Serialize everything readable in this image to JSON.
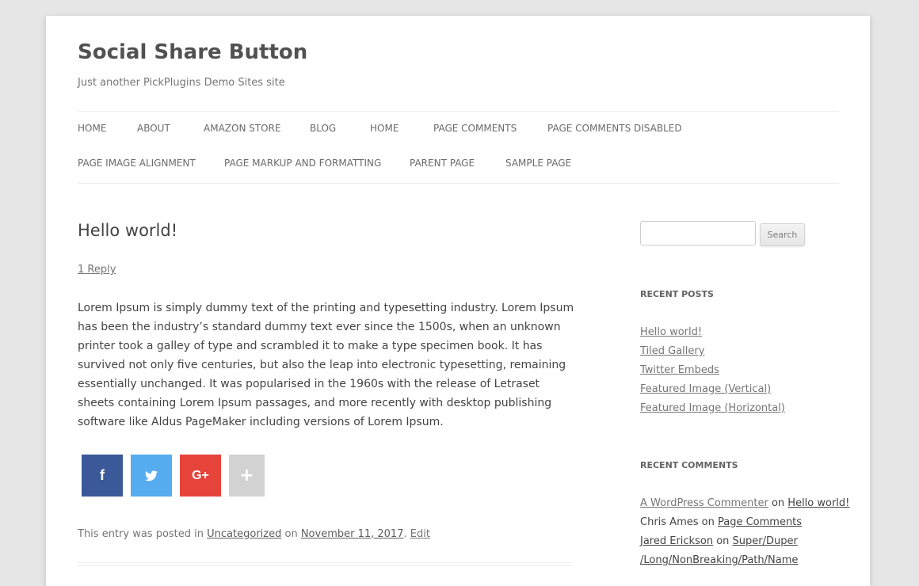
{
  "site": {
    "title": "Social Share Button",
    "description": "Just another PickPlugins Demo Sites site"
  },
  "nav": {
    "row1": [
      "HOME",
      "ABOUT",
      "AMAZON STORE",
      "BLOG",
      "HOME",
      "PAGE COMMENTS",
      "PAGE COMMENTS DISABLED"
    ],
    "row2": [
      "PAGE IMAGE ALIGNMENT",
      "PAGE MARKUP AND FORMATTING",
      "PARENT PAGE",
      "SAMPLE PAGE"
    ]
  },
  "post": {
    "title": "Hello world!",
    "reply_link": "1 Reply",
    "content": "Lorem Ipsum is simply dummy text of the printing and typesetting industry. Lorem Ipsum has been the industry’s standard dummy text ever since the 1500s, when an unknown printer took a galley of type and scrambled it to make a type specimen book. It has survived not only five centuries, but also the leap into electronic typesetting, remaining essentially unchanged. It was popularised in the 1960s with the release of Letraset sheets containing Lorem Ipsum passages, and more recently with desktop publishing software like Aldus PageMaker including versions of Lorem Ipsum.",
    "share": {
      "facebook": "f",
      "twitter_icon": "twitter-icon",
      "googleplus": "G+",
      "more": "+",
      "colors": {
        "facebook": "#3b5998",
        "twitter": "#55acee",
        "googleplus": "#e6443b",
        "more": "#d2d2d2"
      }
    },
    "meta": {
      "prefix": "This entry was posted in ",
      "category": "Uncategorized",
      "on": " on ",
      "date": "November 11, 2017",
      "period": ". ",
      "edit": "Edit"
    }
  },
  "sidebar": {
    "search": {
      "placeholder": "",
      "button": "Search"
    },
    "recent_posts": {
      "title": "RECENT POSTS",
      "items": [
        "Hello world!",
        "Tiled Gallery",
        "Twitter Embeds",
        "Featured Image (Vertical)",
        "Featured Image (Horizontal)"
      ]
    },
    "recent_comments": {
      "title": "RECENT COMMENTS",
      "items": [
        {
          "author": "A WordPress Commenter",
          "on": " on ",
          "post": "Hello world!"
        },
        {
          "author": "Chris Ames",
          "on": " on ",
          "post": "Page Comments"
        },
        {
          "author": "Jared Erickson",
          "on": " on ",
          "post": "Super/Duper"
        },
        {
          "author": "",
          "on": "",
          "post": "/Long/NonBreaking/Path/Name"
        }
      ]
    }
  }
}
